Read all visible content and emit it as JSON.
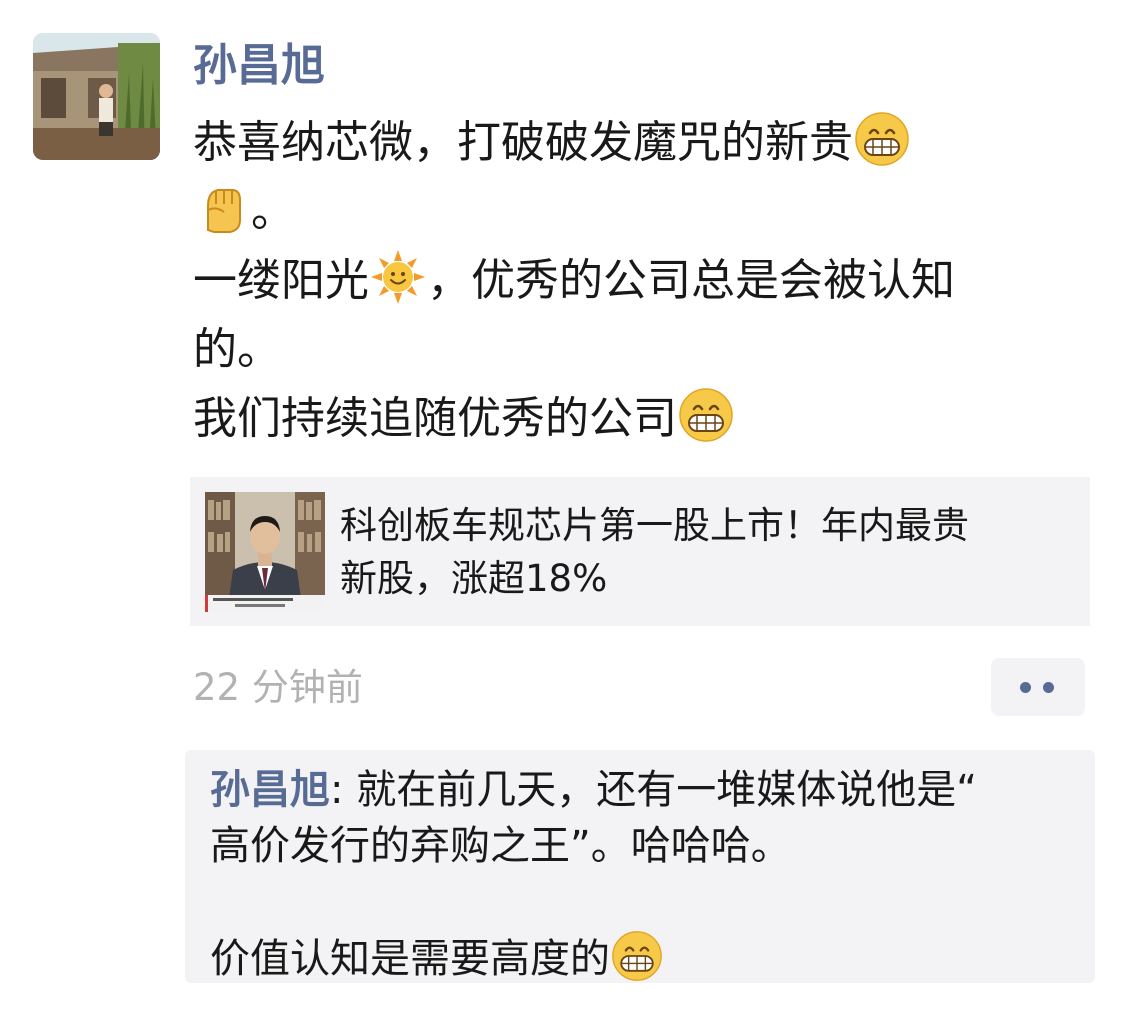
{
  "post": {
    "author": "孙昌旭",
    "lines": [
      {
        "text": "恭喜纳芯微，打破破发魔咒的新贵",
        "emoji": "grin-emoji"
      },
      {
        "text": "",
        "emoji_before": "fist-emoji",
        "text_after": "。"
      },
      {
        "text": "一缕阳光",
        "emoji": "sun-emoji",
        "text_after": "，优秀的公司总是会被认知"
      },
      {
        "text": "的。"
      },
      {
        "text": "我们持续追随优秀的公司",
        "emoji": "grin-emoji"
      }
    ],
    "line_1": "恭喜纳芯微，打破破发魔咒的新贵",
    "line_2_after": "。",
    "line_3_before": "一缕阳光",
    "line_3_after": "，优秀的公司总是会被认知",
    "line_4": "的。",
    "line_5": "我们持续追随优秀的公司"
  },
  "link_card": {
    "title": "科创板车规芯片第一股上市！年内最贵新股，涨超18%",
    "title_line_1": "科创板车规芯片第一股上市！年内最贵",
    "title_line_2": "新股，涨超18%",
    "thumbnail": "news-thumbnail-man-in-suit"
  },
  "meta": {
    "timestamp": "22 分钟前",
    "more_icon": "more-dots-icon"
  },
  "comments": {
    "author": "孙昌旭",
    "separator": ": ",
    "line_1": "就在前几天，还有一堆媒体说他是“",
    "line_2": "高价发行的弃购之王”。哈哈哈。",
    "line_4": "价值认知是需要高度的",
    "line_4_emoji": "grin-emoji"
  },
  "colors": {
    "name_link": "#576b95",
    "timestamp": "#b2b2b2",
    "card_bg": "#f3f3f5",
    "text": "#191919"
  }
}
